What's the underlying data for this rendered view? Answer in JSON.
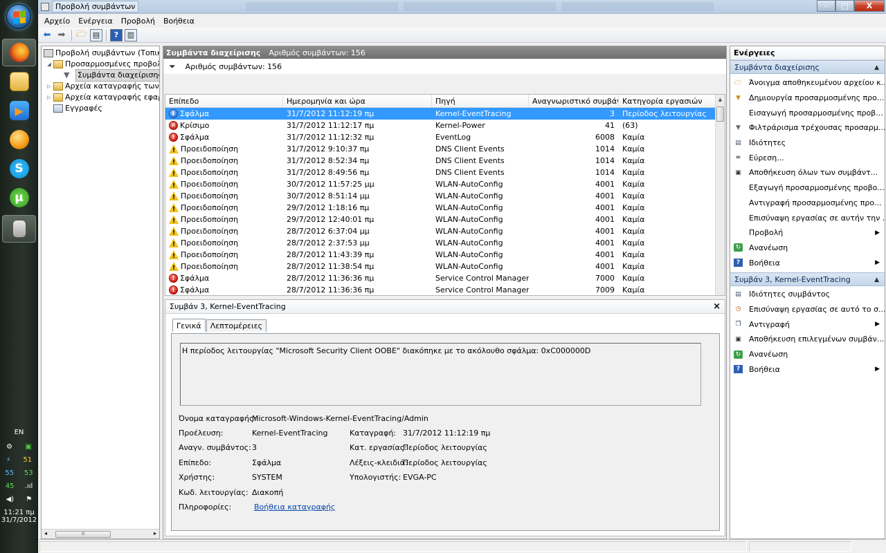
{
  "window": {
    "title": "Προβολή συμβάντων",
    "controls": {
      "minimize": "–",
      "maximize": "□",
      "close": "X"
    }
  },
  "menu": [
    "Αρχείο",
    "Ενέργεια",
    "Προβολή",
    "Βοήθεια"
  ],
  "taskbar": {
    "language": "EN",
    "tray_values": [
      "51",
      "55",
      "53",
      "45"
    ],
    "time": "11:21 πμ",
    "date": "31/7/2012"
  },
  "tree": [
    {
      "label": "Προβολή συμβάντων (Τοπική)",
      "icon": "event-viewer-icon"
    },
    {
      "label": "Προσαρμοσμένες προβολές",
      "icon": "folder-icon"
    },
    {
      "label": "Συμβάντα διαχείρισης",
      "icon": "filter-icon"
    },
    {
      "label": "Αρχεία καταγραφής των Wi",
      "icon": "folder-icon"
    },
    {
      "label": "Αρχεία καταγραφής εφαρμ",
      "icon": "folder-icon"
    },
    {
      "label": "Εγγραφές",
      "icon": "subscriptions-icon"
    }
  ],
  "center": {
    "header_title": "Συμβάντα διαχείρισης",
    "header_count": "Αριθμός συμβάντων: 156",
    "filter_text": "Αριθμός συμβάντων: 156",
    "columns": [
      "Επίπεδο",
      "Ημερομηνία και ώρα",
      "Πηγή",
      "Αναγνωριστικό συμβάν...",
      "Κατηγορία εργασιών"
    ],
    "rows": [
      {
        "level": "Σφάλμα",
        "type": "info",
        "date": "31/7/2012 11:12:19 πμ",
        "source": "Kernel-EventTracing",
        "id": "3",
        "category": "Περίοδος λειτουργίας",
        "selected": true
      },
      {
        "level": "Κρίσιμο",
        "type": "crit",
        "date": "31/7/2012 11:12:17 πμ",
        "source": "Kernel-Power",
        "id": "41",
        "category": "(63)"
      },
      {
        "level": "Σφάλμα",
        "type": "err",
        "date": "31/7/2012 11:12:32 πμ",
        "source": "EventLog",
        "id": "6008",
        "category": "Καμία"
      },
      {
        "level": "Προειδοποίηση",
        "type": "warn",
        "date": "31/7/2012 9:10:37 πμ",
        "source": "DNS Client Events",
        "id": "1014",
        "category": "Καμία"
      },
      {
        "level": "Προειδοποίηση",
        "type": "warn",
        "date": "31/7/2012 8:52:34 πμ",
        "source": "DNS Client Events",
        "id": "1014",
        "category": "Καμία"
      },
      {
        "level": "Προειδοποίηση",
        "type": "warn",
        "date": "31/7/2012 8:49:56 πμ",
        "source": "DNS Client Events",
        "id": "1014",
        "category": "Καμία"
      },
      {
        "level": "Προειδοποίηση",
        "type": "warn",
        "date": "30/7/2012 11:57:25 μμ",
        "source": "WLAN-AutoConfig",
        "id": "4001",
        "category": "Καμία"
      },
      {
        "level": "Προειδοποίηση",
        "type": "warn",
        "date": "30/7/2012 8:51:14 μμ",
        "source": "WLAN-AutoConfig",
        "id": "4001",
        "category": "Καμία"
      },
      {
        "level": "Προειδοποίηση",
        "type": "warn",
        "date": "29/7/2012 1:18:16 πμ",
        "source": "WLAN-AutoConfig",
        "id": "4001",
        "category": "Καμία"
      },
      {
        "level": "Προειδοποίηση",
        "type": "warn",
        "date": "29/7/2012 12:40:01 πμ",
        "source": "WLAN-AutoConfig",
        "id": "4001",
        "category": "Καμία"
      },
      {
        "level": "Προειδοποίηση",
        "type": "warn",
        "date": "28/7/2012 6:37:04 μμ",
        "source": "WLAN-AutoConfig",
        "id": "4001",
        "category": "Καμία"
      },
      {
        "level": "Προειδοποίηση",
        "type": "warn",
        "date": "28/7/2012 2:37:53 μμ",
        "source": "WLAN-AutoConfig",
        "id": "4001",
        "category": "Καμία"
      },
      {
        "level": "Προειδοποίηση",
        "type": "warn",
        "date": "28/7/2012 11:43:39 πμ",
        "source": "WLAN-AutoConfig",
        "id": "4001",
        "category": "Καμία"
      },
      {
        "level": "Προειδοποίηση",
        "type": "warn",
        "date": "28/7/2012 11:38:54 πμ",
        "source": "WLAN-AutoConfig",
        "id": "4001",
        "category": "Καμία"
      },
      {
        "level": "Σφάλμα",
        "type": "err",
        "date": "28/7/2012 11:36:36 πμ",
        "source": "Service Control Manager",
        "id": "7000",
        "category": "Καμία"
      },
      {
        "level": "Σφάλμα",
        "type": "err",
        "date": "28/7/2012 11:36:36 πμ",
        "source": "Service Control Manager",
        "id": "7009",
        "category": "Καμία"
      }
    ]
  },
  "detail": {
    "title": "Συμβάν 3, Kernel-EventTracing",
    "close": "×",
    "tabs": [
      "Γενικά",
      "Λεπτομέρειες"
    ],
    "message": "Η περίοδος λειτουργίας \"Microsoft Security Client OOBE\" διακόπηκε με το ακόλουθο σφάλμα: 0xC000000D",
    "log_name_label": "Όνομα καταγραφής:",
    "log_name": "Microsoft-Windows-Kernel-EventTracing/Admin",
    "source_label": "Προέλευση:",
    "source": "Kernel-EventTracing",
    "logged_label": "Καταγραφή:",
    "logged": "31/7/2012 11:12:19 πμ",
    "event_id_label": "Αναγν. συμβάντος:",
    "event_id": "3",
    "task_label": "Κατ. εργασίας:",
    "task": "Περίοδος λειτουργίας",
    "level_label": "Επίπεδο:",
    "level": "Σφάλμα",
    "keywords_label": "Λέξεις-κλειδιά:",
    "keywords": "Περίοδος λειτουργίας",
    "user_label": "Χρήστης:",
    "user": "SYSTEM",
    "computer_label": "Υπολογιστής:",
    "computer": "EVGA-PC",
    "opcode_label": "Κωδ. λειτουργίας:",
    "opcode": "Διακοπή",
    "info_label": "Πληροφορίες:",
    "info_link": "Βοήθεια καταγραφής"
  },
  "actions": {
    "title": "Ενέργειες",
    "section1": {
      "title": "Συμβάντα διαχείρισης",
      "items": [
        {
          "label": "Άνοιγμα αποθηκευμένου αρχείου κ...",
          "icon": "open-folder-icon"
        },
        {
          "label": "Δημιουργία προσαρμοσμένης προ...",
          "icon": "filter-create-icon"
        },
        {
          "label": "Εισαγωγή προσαρμοσμένης προβ...",
          "icon": ""
        },
        {
          "label": "Φιλτράρισμα τρέχουσας προσαρμ...",
          "icon": "filter-icon"
        },
        {
          "label": "Ιδιότητες",
          "icon": "properties-icon"
        },
        {
          "label": "Εύρεση...",
          "icon": "binoculars-icon"
        },
        {
          "label": "Αποθήκευση όλων των συμβάντ...",
          "icon": "save-icon"
        },
        {
          "label": "Εξαγωγή προσαρμοσμένης προβο...",
          "icon": ""
        },
        {
          "label": "Αντιγραφή προσαρμοσμένης προ...",
          "icon": ""
        },
        {
          "label": "Επισύναψη εργασίας σε αυτήν την ...",
          "icon": ""
        },
        {
          "label": "Προβολή",
          "icon": "",
          "submenu": true
        },
        {
          "label": "Ανανέωση",
          "icon": "refresh-icon"
        },
        {
          "label": "Βοήθεια",
          "icon": "help-icon",
          "submenu": true
        }
      ]
    },
    "section2": {
      "title": "Συμβάν 3, Kernel-EventTracing",
      "items": [
        {
          "label": "Ιδιότητες συμβάντος",
          "icon": "properties-icon"
        },
        {
          "label": "Επισύναψη εργασίας σε αυτό το σ...",
          "icon": "task-icon"
        },
        {
          "label": "Αντιγραφή",
          "icon": "copy-icon",
          "submenu": true
        },
        {
          "label": "Αποθήκευση επιλεγμένων συμβάν...",
          "icon": "save-icon"
        },
        {
          "label": "Ανανέωση",
          "icon": "refresh-icon"
        },
        {
          "label": "Βοήθεια",
          "icon": "help-icon",
          "submenu": true
        }
      ]
    }
  }
}
